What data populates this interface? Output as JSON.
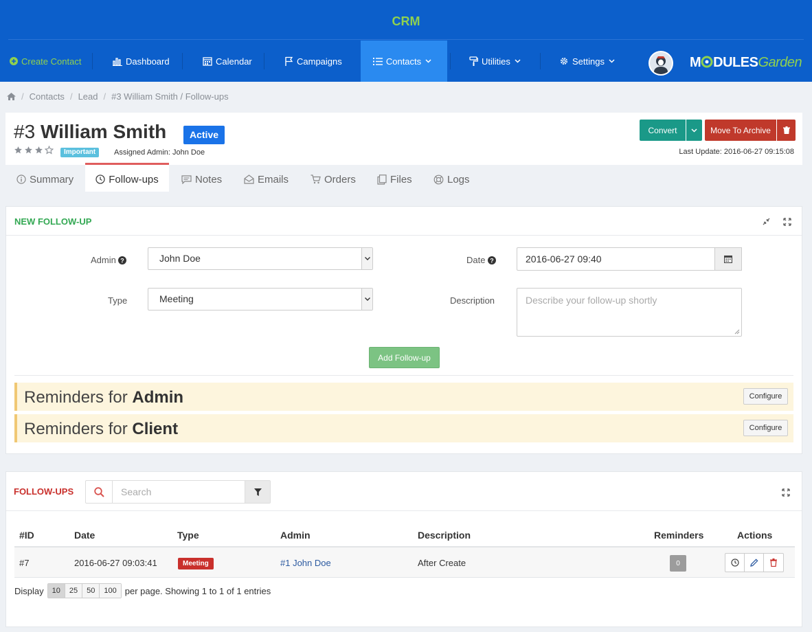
{
  "app": {
    "title": "CRM"
  },
  "nav": {
    "create_contact": "Create Contact",
    "dashboard": "Dashboard",
    "calendar": "Calendar",
    "campaigns": "Campaigns",
    "contacts": "Contacts",
    "utilities": "Utilities",
    "settings": "Settings"
  },
  "logo": {
    "part1": "M",
    "part2": "DULES",
    "part3": "Garden"
  },
  "breadcrumb": {
    "contacts": "Contacts",
    "lead": "Lead",
    "current": "#3 William Smith / Follow-ups"
  },
  "contact": {
    "id": "#3",
    "name": "William Smith",
    "status": "Active",
    "rating": 3,
    "rating_max": 4,
    "priority": "Important",
    "assigned_admin": "Assigned Admin: John Doe",
    "last_update": "Last Update: 2016-06-27 09:15:08"
  },
  "actions": {
    "convert": "Convert",
    "move_to_archive": "Move To Archive"
  },
  "tabs": [
    "Summary",
    "Follow-ups",
    "Notes",
    "Emails",
    "Orders",
    "Files",
    "Logs"
  ],
  "new_followup": {
    "title": "NEW FOLLOW-UP",
    "admin_label": "Admin",
    "admin_value": "John Doe",
    "type_label": "Type",
    "type_value": "Meeting",
    "date_label": "Date",
    "date_value": "2016-06-27 09:40",
    "description_label": "Description",
    "description_placeholder": "Describe your follow-up shortly",
    "add_button": "Add Follow-up",
    "reminders": [
      {
        "prefix": "Reminders for ",
        "target": "Admin",
        "button": "Configure"
      },
      {
        "prefix": "Reminders for ",
        "target": "Client",
        "button": "Configure"
      }
    ]
  },
  "followups": {
    "title": "FOLLOW-UPS",
    "search_placeholder": "Search",
    "columns": [
      "#ID",
      "Date",
      "Type",
      "Admin",
      "Description",
      "Reminders",
      "Actions"
    ],
    "rows": [
      {
        "id": "#7",
        "date": "2016-06-27 09:03:41",
        "type": "Meeting",
        "admin": "#1 John Doe",
        "description": "After Create",
        "reminders": "0"
      }
    ],
    "pager": {
      "display": "Display",
      "sizes": [
        "10",
        "25",
        "50",
        "100"
      ],
      "selected": "10",
      "summary": "per page. Showing 1 to 1 of 1 entries"
    }
  },
  "colors": {
    "header": "#0c5fcb",
    "nav_active": "#2a8af0",
    "accent_green": "#8fd14f",
    "convert": "#1a9988",
    "archive": "#c0392b",
    "status_active": "#1a73e8"
  }
}
